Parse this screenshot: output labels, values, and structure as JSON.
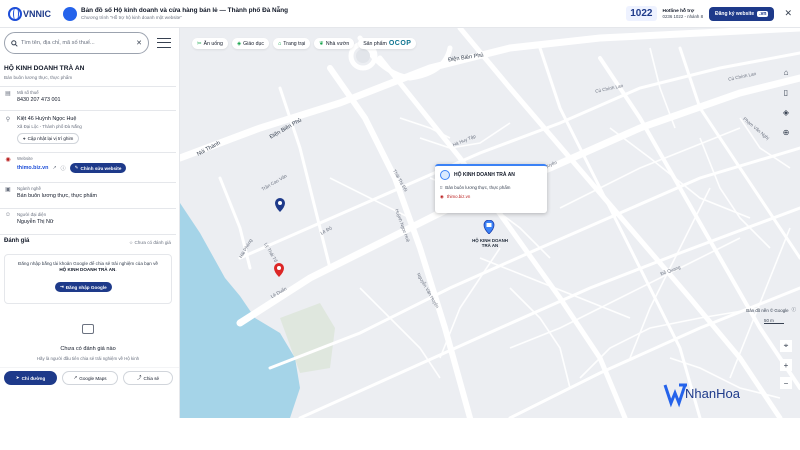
{
  "header": {
    "logo_text": "VNNIC",
    "title": "Bản đồ số Hộ kinh doanh và cửa hàng bán lẻ — Thành phố Đà Nẵng",
    "subtitle": "Chương trình \"Hỗ trợ hộ kinh doanh một website\"",
    "hotline_number": "1022",
    "hotline_label": "Hotline hỗ trợ",
    "hotline_detail": "0236 1022 - nhánh 8",
    "register_label": "Đăng ký website",
    "register_suffix": ".vn",
    "close": "✕"
  },
  "search": {
    "placeholder": "Tìm tên, địa chỉ, mã số thuế...",
    "clear": "✕"
  },
  "business": {
    "name": "HỘ KINH DOANH TRÀ AN",
    "category": "Bán buôn lương thực, thực phẩm",
    "tax_label": "Mã số thuế",
    "tax_value": "8430 207 473 001",
    "address_line1": "Kiệt 46 Huỳnh Ngọc Huệ",
    "address_line2": "Xã Đại Lộc - Thành phố Đà Nẵng",
    "update_location": "Cập nhật lại vị trí ghim",
    "website_label": "Website",
    "website_value": "thimo.biz.vn",
    "edit_website": "Chỉnh sửa website",
    "industry_label": "Ngành nghề",
    "industry_value": "Bán buôn lương thực, thực phẩm",
    "owner_label": "Người đại diện",
    "owner_value": "Nguyễn Thị Nữ"
  },
  "rating": {
    "heading": "Đánh giá",
    "status": "Chưa có đánh giá",
    "login_msg_1": "Đăng nhập bằng tài khoản Google để chia sẻ trải nghiệm của bạn về",
    "login_msg_biz": "HỘ KINH DOANH TRÀ AN",
    "login_btn": "Đăng nhập Google",
    "empty_title": "Chưa có đánh giá nào",
    "empty_sub": "Hãy là người đầu tiên chia sẻ trải nghiệm về Hộ kinh"
  },
  "actions": {
    "directions": "Chỉ đường",
    "google_maps": "Google Maps",
    "share": "Chia sẻ"
  },
  "categories": [
    {
      "label": "Ăn uống",
      "icon": "fork-icon"
    },
    {
      "label": "Giáo dục",
      "icon": "graduation-icon"
    },
    {
      "label": "Trang trại",
      "icon": "farm-icon"
    },
    {
      "label": "Nhà vườn",
      "icon": "garden-icon"
    },
    {
      "label": "Sản phẩm",
      "icon": "product-icon",
      "suffix": "OCOP"
    }
  ],
  "streets": {
    "s1": "Điện Biên Phủ",
    "s2": "Điện Biên Phủ",
    "s3": "Cù Chính Lan",
    "s4": "Cù Chính Lan",
    "s5": "Phạm Văn Nghị",
    "s6": "Hà Huy Tập",
    "s7": "Núi Thành",
    "s8": "Trần Cao Vân",
    "s9": "Huỳnh Ngọc Huệ",
    "s10": "Lê Độ",
    "s11": "Thái Thị Bôi",
    "s12": "Nguyễn Văn Huyên",
    "s13": "Lý Thái Tổ",
    "s14": "Hải Phòng",
    "s15": "Nguyễn Phước Nguyên",
    "s16": "Đỗ Quang",
    "s17": "Lê Duẩn"
  },
  "popup": {
    "title": "HỘ KINH DOANH TRÀ AN",
    "category": "Bán buôn lương thực, thực phẩm",
    "website": "thimo.biz.vn"
  },
  "marker_label": "HỘ KINH DOANH TRÀ AN",
  "map_attribution": "Bản đồ nền © Google",
  "map_scale": "50 m",
  "brand": "NhanHoa",
  "colors": {
    "primary": "#1e3a8a",
    "accent": "#3b82f6",
    "water": "#a5d4e8",
    "road": "#ffffff",
    "map_bg": "#eef0f3"
  }
}
